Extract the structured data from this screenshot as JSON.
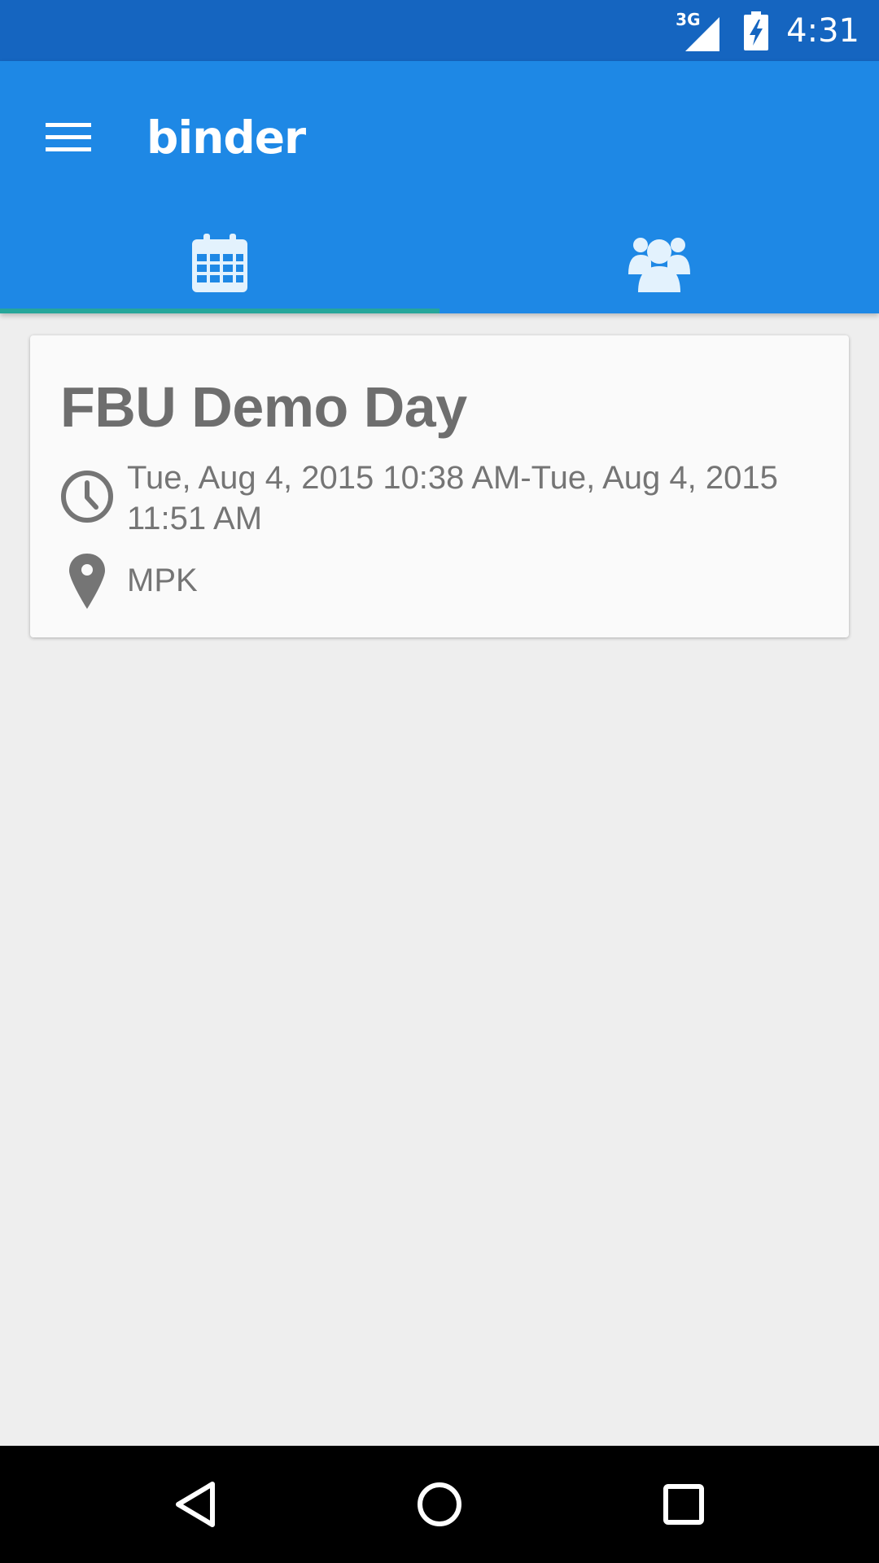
{
  "status_bar": {
    "network": "3G",
    "time": "4:31"
  },
  "toolbar": {
    "title": "binder",
    "menu_icon": "hamburger-menu-icon"
  },
  "tabs": [
    {
      "icon": "calendar-icon",
      "selected": true
    },
    {
      "icon": "group-icon",
      "selected": false
    }
  ],
  "event": {
    "title": "FBU Demo Day",
    "time_range": "Tue, Aug 4, 2015 10:38 AM-Tue, Aug 4, 2015 11:51 AM",
    "location": "MPK",
    "time_icon": "clock-icon",
    "location_icon": "map-pin-icon"
  },
  "nav_bar": {
    "back_icon": "back-triangle-icon",
    "home_icon": "home-circle-icon",
    "recents_icon": "recents-square-icon"
  },
  "colors": {
    "status_bar": "#1565C0",
    "toolbar": "#1E88E5",
    "tab_indicator": "#26A69A",
    "tab_icon": "#E3F2FD",
    "background": "#EEEEEE",
    "card": "#FAFAFA",
    "card_text": "#757575"
  }
}
